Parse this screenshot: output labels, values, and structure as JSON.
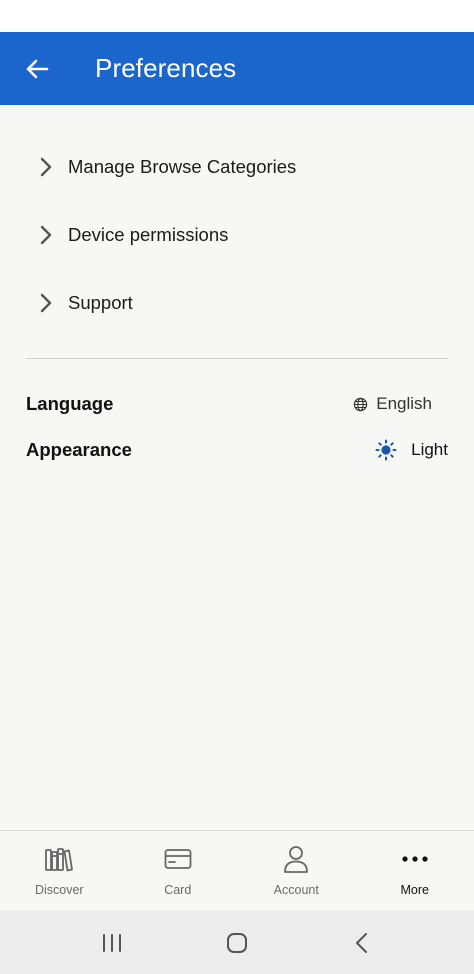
{
  "header": {
    "title": "Preferences",
    "back_icon": "arrow-left-icon",
    "bg_color": "#1a66cc"
  },
  "menu": {
    "items": [
      {
        "label": "Manage Browse Categories",
        "icon": "chevron-right-icon"
      },
      {
        "label": "Device permissions",
        "icon": "chevron-right-icon"
      },
      {
        "label": "Support",
        "icon": "chevron-right-icon"
      }
    ]
  },
  "settings": {
    "language": {
      "label": "Language",
      "value": "English",
      "icon": "globe-icon"
    },
    "appearance": {
      "label": "Appearance",
      "value": "Light",
      "icon": "sun-icon",
      "icon_color": "#1a56b0"
    }
  },
  "bottom_nav": {
    "items": [
      {
        "label": "Discover",
        "icon": "books-icon",
        "active": false
      },
      {
        "label": "Card",
        "icon": "card-icon",
        "active": false
      },
      {
        "label": "Account",
        "icon": "person-icon",
        "active": false
      },
      {
        "label": "More",
        "icon": "more-dots-icon",
        "active": true
      }
    ]
  },
  "system_nav": {
    "buttons": [
      "recents-icon",
      "home-icon",
      "back-icon"
    ]
  }
}
